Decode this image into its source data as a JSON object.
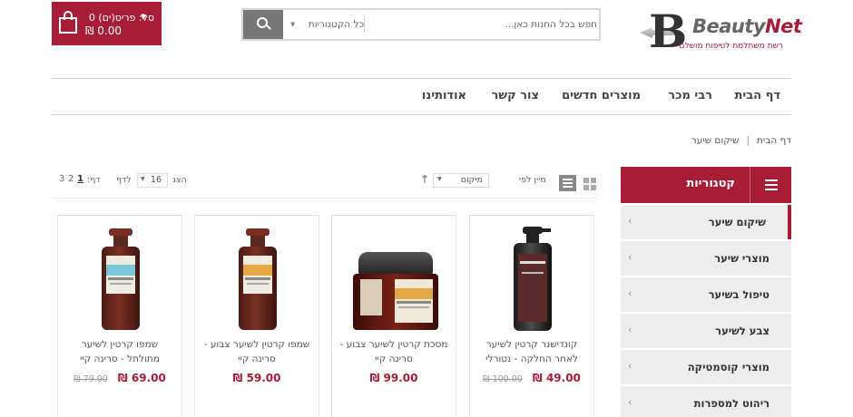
{
  "header": {
    "cart": {
      "label": "סל: פריס(ים) 0",
      "total": "₪ 0.00"
    },
    "search": {
      "placeholder": "חפש בכל החנות כאן...",
      "category_label": "כל הקטגוריות"
    },
    "logo": {
      "name_part1": "Beauty",
      "name_part2": "Net",
      "tagline": "רשת משתלמת לטיפוח מושלם"
    }
  },
  "nav": {
    "items": [
      "דף הבית",
      "רבי מכר",
      "מוצרים חדשים",
      "צור קשר",
      "אודותינו"
    ]
  },
  "breadcrumb": {
    "home": "דף הבית",
    "separator": "|",
    "current": "שיקום שיער"
  },
  "sidebar": {
    "title": "קטגוריות",
    "items": [
      {
        "label": "שיקום שיער"
      },
      {
        "label": "מוצרי שיער"
      },
      {
        "label": "טיפול בשיער"
      },
      {
        "label": "צבע לשיער"
      },
      {
        "label": "מוצרי קוסמטיקה"
      },
      {
        "label": "ריהוט למספרות"
      }
    ]
  },
  "toolbar": {
    "sort_label": "מיין לפי",
    "sort_value": "מיקום",
    "show_label": "הצג",
    "show_value": "16",
    "per_page_label": "לדף",
    "page_label": "דף:",
    "pages": [
      "1",
      "2",
      "3"
    ],
    "current_page": "1"
  },
  "products": [
    {
      "title": "קונדישנר קרטין לשיער לאחר החלקה - נטורלי",
      "price": "49.00 ₪",
      "old_price": "100.00 ₪"
    },
    {
      "title": "מסכת קרטין לשיער צבוע - סרינה קיי",
      "price": "99.00 ₪",
      "old_price": ""
    },
    {
      "title": "שמפו קרטין לשיער צבוע - סרינה קיי",
      "price": "59.00 ₪",
      "old_price": ""
    },
    {
      "title": "שמפו קרטין לשיער מתולתל - סרינה קיי",
      "price": "69.00 ₪",
      "old_price": "79.00 ₪"
    }
  ],
  "colors": {
    "brand": "#a61d35",
    "sidebar_bg": "#ededed"
  },
  "icons": [
    "shopping-bag-icon",
    "search-icon",
    "caret-down-icon",
    "menu-icon",
    "chevron-left-icon",
    "grid-view-icon",
    "list-view-icon",
    "sort-arrow-icon"
  ]
}
